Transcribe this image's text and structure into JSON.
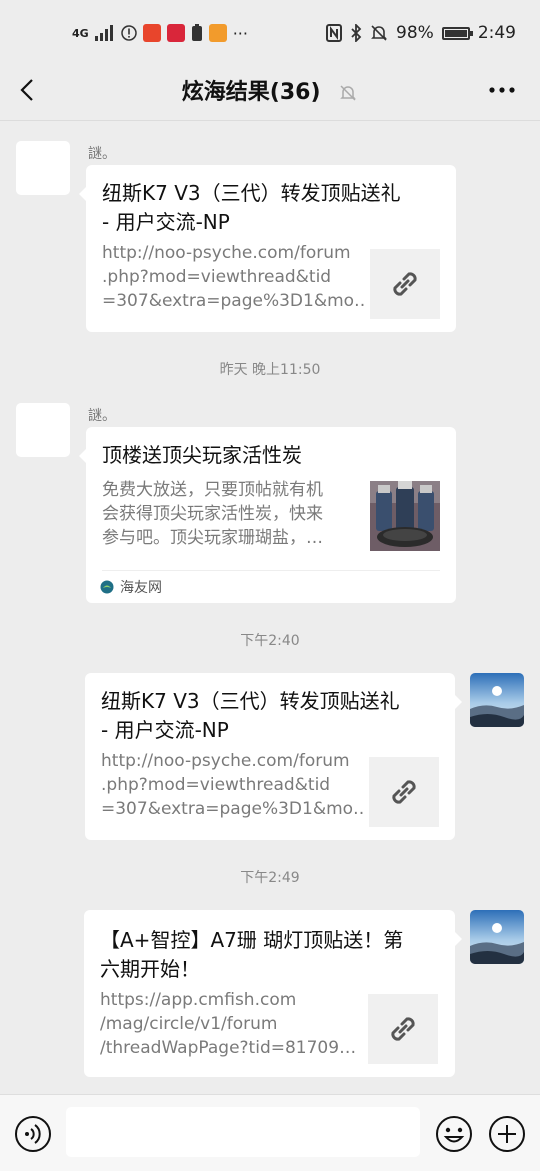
{
  "status_bar": {
    "network": "4G",
    "battery_percent": "98%",
    "battery_level": 0.98,
    "time": "2:49",
    "more": "···"
  },
  "header": {
    "title": "炫海结果(36)"
  },
  "messages": [
    {
      "side": "left",
      "sender": "謎。",
      "title_lines": [
        "纽斯K7 V3（三代）转发顶贴送礼",
        "- 用户交流-NP"
      ],
      "desc_lines": [
        "http://noo-psyche.com/forum",
        ".php?mod=viewthread&tid",
        "=307&extra=page%3D1&mo…"
      ],
      "thumb": "link-icon"
    },
    {
      "timestamp": "昨天 晚上11:50"
    },
    {
      "side": "left",
      "sender": "謎。",
      "title_lines": [
        "顶楼送顶尖玩家活性炭"
      ],
      "desc_lines": [
        "免费大放送，只要顶帖就有机",
        "会获得顶尖玩家活性炭，快来",
        "参与吧。顶尖玩家珊瑚盐，…"
      ],
      "thumb": "product-photo",
      "source": "海友网"
    },
    {
      "timestamp": "下午2:40"
    },
    {
      "side": "right",
      "title_lines": [
        "纽斯K7 V3（三代）转发顶贴送礼",
        "- 用户交流-NP"
      ],
      "desc_lines": [
        "http://noo-psyche.com/forum",
        ".php?mod=viewthread&tid",
        "=307&extra=page%3D1&mo…"
      ],
      "thumb": "link-icon"
    },
    {
      "timestamp": "下午2:49"
    },
    {
      "side": "right",
      "title_lines": [
        "【A+智控】A7珊 瑚灯顶贴送！第",
        "六期开始！"
      ],
      "desc_lines": [
        "https://app.cmfish.com",
        "/mag/circle/v1/forum",
        "/threadWapPage?tid=81709…"
      ],
      "thumb": "link-icon"
    }
  ],
  "input_bar": {
    "text_value": ""
  },
  "colors": {
    "background": "#ededed",
    "card": "#ffffff",
    "timestamp": "#888888"
  }
}
